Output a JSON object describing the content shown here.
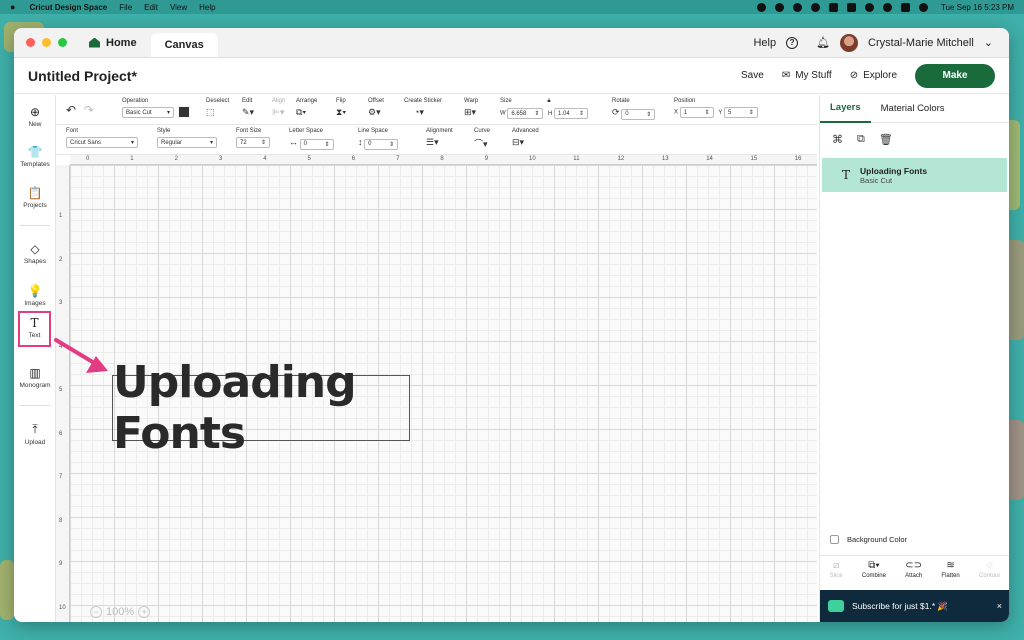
{
  "menubar": {
    "app_name": "Cricut Design Space",
    "items": [
      "File",
      "Edit",
      "View",
      "Help"
    ],
    "datetime": "Tue Sep 16  5:23 PM"
  },
  "titlebar": {
    "home_tab": "Home",
    "canvas_tab": "Canvas",
    "help_label": "Help",
    "help_icon_glyph": "?",
    "user_name": "Crystal-Marie Mitchell"
  },
  "header": {
    "project_title": "Untitled Project*",
    "save_label": "Save",
    "my_stuff_label": "My Stuff",
    "explore_label": "Explore",
    "make_label": "Make"
  },
  "sidebar": {
    "items": [
      {
        "label": "New",
        "icon": "plus-circle-icon",
        "glyph": "⊕"
      },
      {
        "label": "Templates",
        "icon": "shirt-icon",
        "glyph": "👕"
      },
      {
        "label": "Projects",
        "icon": "clipboard-icon",
        "glyph": "📋"
      },
      {
        "label": "Shapes",
        "icon": "shapes-icon",
        "glyph": "◇"
      },
      {
        "label": "Images",
        "icon": "bulb-icon",
        "glyph": "💡"
      },
      {
        "label": "Text",
        "icon": "text-icon",
        "glyph": "T"
      },
      {
        "label": "Monogram",
        "icon": "monogram-icon",
        "glyph": "▥"
      },
      {
        "label": "Upload",
        "icon": "upload-icon",
        "glyph": "⤒"
      }
    ]
  },
  "toolbar1": {
    "operation_label": "Operation",
    "operation_value": "Basic Cut",
    "deselect_label": "Deselect",
    "edit_label": "Edit",
    "align_label": "Align",
    "arrange_label": "Arrange",
    "flip_label": "Flip",
    "offset_label": "Offset",
    "create_sticker_label": "Create Sticker",
    "warp_label": "Warp",
    "size_label": "Size",
    "size_w_label": "W",
    "size_w": "6.658",
    "size_h_label": "H",
    "size_h": "1.04",
    "rotate_label": "Rotate",
    "rotate_value": "0",
    "position_label": "Position",
    "pos_x_label": "X",
    "pos_x": "1",
    "pos_y_label": "Y",
    "pos_y": "5"
  },
  "toolbar2": {
    "font_label": "Font",
    "font_value": "Cricut Sans",
    "style_label": "Style",
    "style_value": "Regular",
    "font_size_label": "Font Size",
    "font_size_value": "72",
    "letter_space_label": "Letter Space",
    "letter_space_value": "0",
    "line_space_label": "Line Space",
    "line_space_value": "0",
    "alignment_label": "Alignment",
    "curve_label": "Curve",
    "advanced_label": "Advanced"
  },
  "ruler": {
    "top": [
      "0",
      "1",
      "2",
      "3",
      "4",
      "5",
      "6",
      "7",
      "8",
      "9",
      "10",
      "11",
      "12",
      "13",
      "14",
      "15",
      "16"
    ],
    "left": [
      "1",
      "2",
      "3",
      "4",
      "5",
      "6",
      "7",
      "8",
      "9",
      "10"
    ]
  },
  "canvas": {
    "text_object": "Uploading Fonts",
    "zoom": "100%"
  },
  "right_panel": {
    "tabs": [
      "Layers",
      "Material Colors"
    ],
    "layer_name": "Uploading Fonts",
    "layer_sub": "Basic Cut",
    "background_color_label": "Background Color",
    "actions": [
      "Slice",
      "Combine",
      "Attach",
      "Flatten",
      "Contour"
    ],
    "promo_text": "Subscribe for just $1.*",
    "promo_emoji": "🎉",
    "promo_close": "×"
  },
  "colors": {
    "brand_green": "#1a6b3c",
    "layer_highlight": "#b4e6d6",
    "annotation_pink": "#e23c84",
    "promo_bg": "#0f2a3d"
  }
}
